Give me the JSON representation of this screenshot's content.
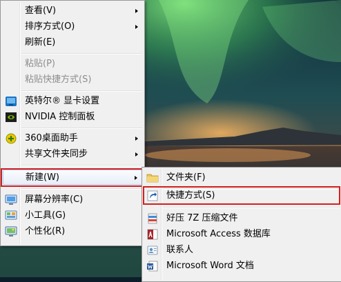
{
  "context_menu": {
    "items": [
      {
        "label": "查看(V)"
      },
      {
        "label": "排序方式(O)"
      },
      {
        "label": "刷新(E)"
      },
      {
        "label": "粘贴(P)"
      },
      {
        "label": "粘贴快捷方式(S)"
      },
      {
        "label": "英特尔® 显卡设置"
      },
      {
        "label": "NVIDIA 控制面板"
      },
      {
        "label": "360桌面助手"
      },
      {
        "label": "共享文件夹同步"
      },
      {
        "label": "新建(W)"
      },
      {
        "label": "屏幕分辨率(C)"
      },
      {
        "label": "小工具(G)"
      },
      {
        "label": "个性化(R)"
      }
    ]
  },
  "new_submenu": {
    "items": [
      {
        "label": "文件夹(F)"
      },
      {
        "label": "快捷方式(S)"
      },
      {
        "label": "好压 7Z 压缩文件"
      },
      {
        "label": "Microsoft Access 数据库"
      },
      {
        "label": "联系人"
      },
      {
        "label": "Microsoft Word 文档"
      }
    ]
  },
  "colors": {
    "highlight_border": "#d51d1d",
    "menu_background": "#f0f0f0"
  }
}
